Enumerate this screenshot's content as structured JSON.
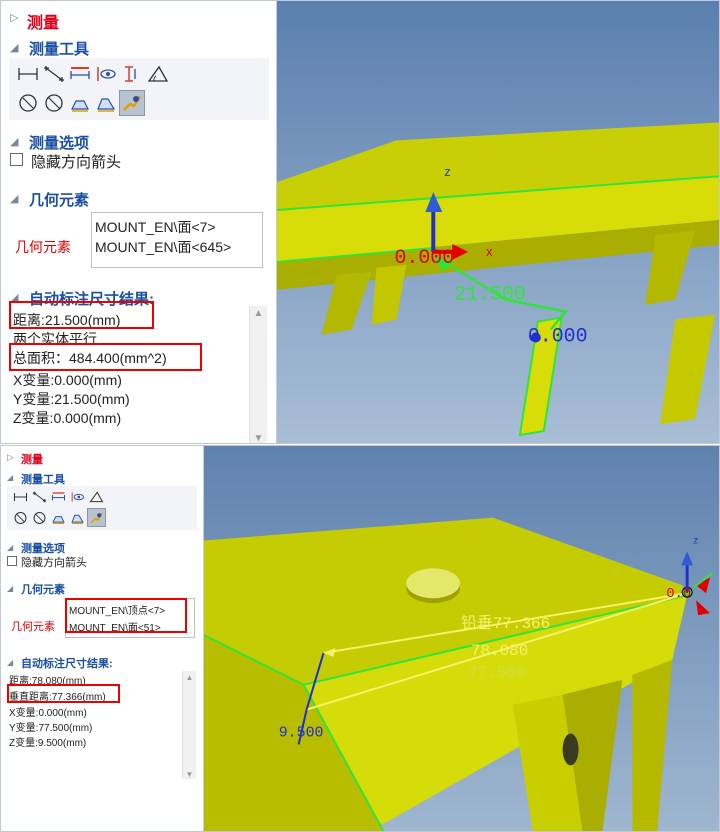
{
  "colors": {
    "title": "#e0001b",
    "section": "#1a4fa3",
    "model": "#d4d800",
    "edge": "#31e43a",
    "highlight": "#e00000",
    "bg_top": "#5f82ae",
    "bg_bottom": "#a9bfd6"
  },
  "shot1": {
    "panel": {
      "title": "测量",
      "tools_section": "测量工具",
      "tool_icons_row1": [
        "distance-icon",
        "point-distance-icon",
        "angle-icon",
        "visible-icon",
        "vertical-distance-icon",
        "angle-measure-icon"
      ],
      "tool_icons_row2": [
        "circle-diameter-icon",
        "circle-slash-icon",
        "area-icon",
        "area2-icon",
        "auto-measure-icon"
      ],
      "options_section": "测量选项",
      "hide_arrow_label": "隐藏方向箭头",
      "geo_section": "几何元素",
      "geo_label": "几何元素",
      "geo_items": [
        "MOUNT_EN\\面<7>",
        "MOUNT_EN\\面<645>"
      ],
      "results_section": "自动标注尺寸结果:",
      "results": [
        "距离:21.500(mm)",
        "两个实体平行",
        "总面积：484.400(mm^2)",
        "X变量:0.000(mm)",
        "Y变量:21.500(mm)",
        "Z变量:0.000(mm)"
      ]
    },
    "viewport": {
      "axis_z": "z",
      "axis_x": "x",
      "origin_value": "0.000",
      "distance": "21.500",
      "end_value": "0.000"
    }
  },
  "shot2": {
    "panel": {
      "title": "测量",
      "tools_section": "测量工具",
      "options_section": "测量选项",
      "hide_arrow_label": "隐藏方向箭头",
      "geo_section": "几何元素",
      "geo_label": "几何元素",
      "geo_items": [
        "MOUNT_EN\\顶点<7>",
        "MOUNT_EN\\面<51>"
      ],
      "results_section": "自动标注尺寸结果:",
      "results": [
        "距离:78.080(mm)",
        "垂直距离:77.366(mm)",
        "X变量:0.000(mm)",
        "Y变量:77.500(mm)",
        "Z变量:9.500(mm)"
      ]
    },
    "viewport": {
      "axis_z": "z",
      "origin_value": "0.0",
      "perpendicular": "铅垂77.366",
      "distance": "78.080",
      "ghost": "77.500",
      "z_value": "9.500"
    }
  }
}
